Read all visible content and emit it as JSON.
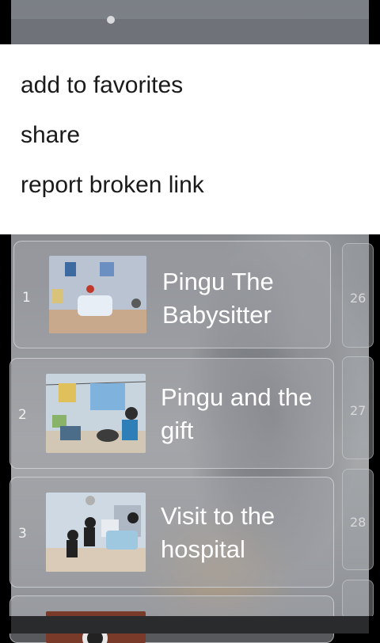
{
  "context_menu": {
    "items": [
      {
        "label": "add to favorites"
      },
      {
        "label": "share"
      },
      {
        "label": "report broken link"
      }
    ]
  },
  "episodes": [
    {
      "number": "1",
      "title": "Pingu The Babysitter"
    },
    {
      "number": "2",
      "title": "Pingu and the gift"
    },
    {
      "number": "3",
      "title": "Visit to the hospital"
    }
  ],
  "side_column": {
    "numbers": [
      "26",
      "27",
      "28"
    ]
  },
  "colors": {
    "menu_background": "#ffffff",
    "menu_text": "#1a1a1a",
    "card_text": "#ffffff"
  }
}
